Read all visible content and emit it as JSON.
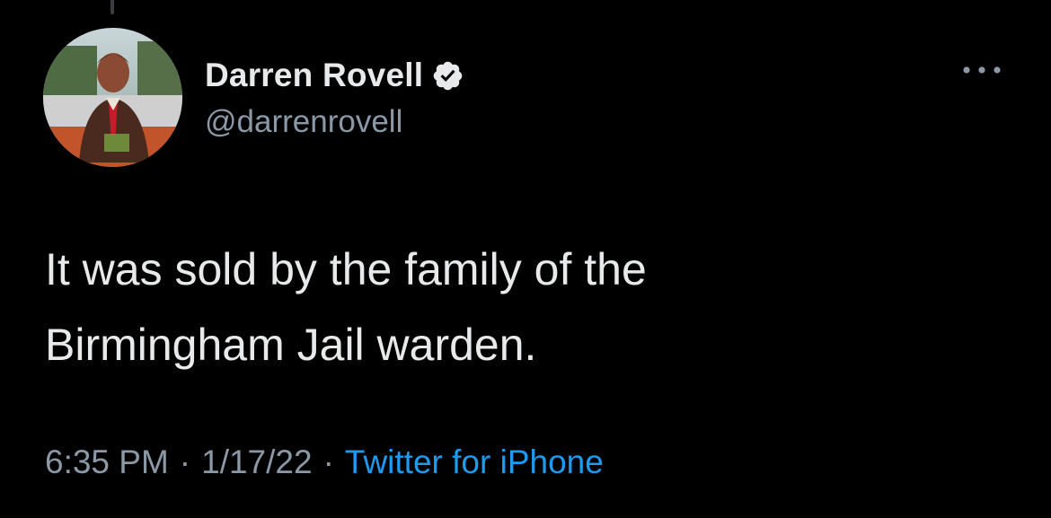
{
  "author": {
    "display_name": "Darren Rovell",
    "handle": "@darrenrovell",
    "verified": true,
    "avatar_icon": "profile-photo"
  },
  "tweet": {
    "text_lines": [
      "It was sold by the family of the",
      "Birmingham Jail warden."
    ]
  },
  "meta": {
    "time": "6:35 PM",
    "separator": "·",
    "date": "1/17/22",
    "source": "Twitter for iPhone"
  },
  "icons": {
    "more": "more-options-icon",
    "verified": "verified-badge-icon"
  },
  "colors": {
    "background": "#000000",
    "primary_text": "#e7e9ea",
    "secondary_text": "#8b98a5",
    "link": "#1d9bf0"
  }
}
